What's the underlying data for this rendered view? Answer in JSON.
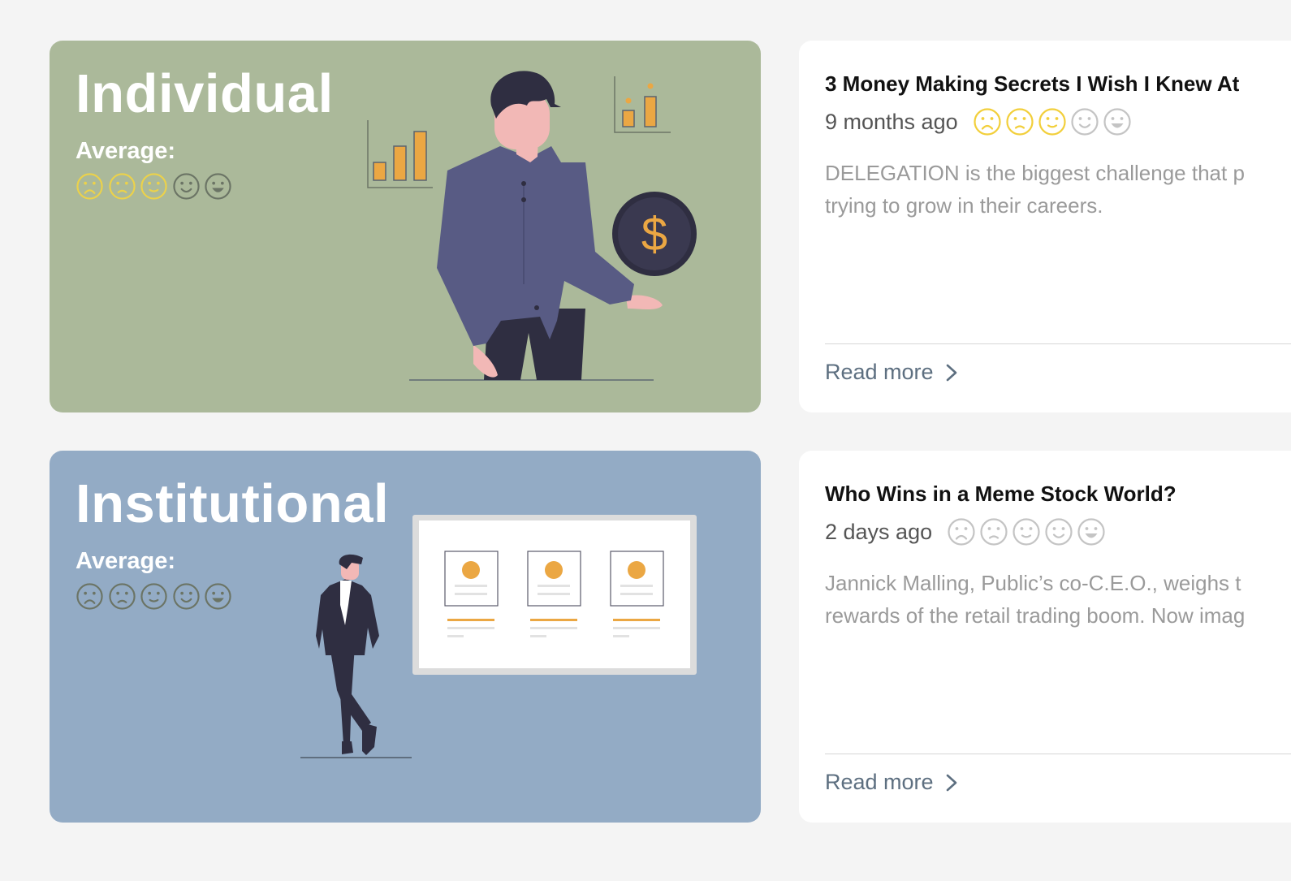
{
  "segments": [
    {
      "title": "Individual",
      "average_label": "Average:",
      "rating": [
        {
          "icon": "frown-face-icon",
          "active": true
        },
        {
          "icon": "slightly-frown-face-icon",
          "active": true
        },
        {
          "icon": "neutral-smile-face-icon",
          "active": true
        },
        {
          "icon": "smile-face-icon",
          "active": false
        },
        {
          "icon": "grin-face-icon",
          "active": false
        }
      ],
      "background": "#abb99a",
      "illustration": "person-with-dollar-coin-illustration"
    },
    {
      "title": "Institutional",
      "average_label": "Average:",
      "rating": [
        {
          "icon": "frown-face-icon",
          "active": false
        },
        {
          "icon": "slightly-frown-face-icon",
          "active": false
        },
        {
          "icon": "neutral-smile-face-icon",
          "active": false
        },
        {
          "icon": "smile-face-icon",
          "active": false
        },
        {
          "icon": "grin-face-icon",
          "active": false
        }
      ],
      "background": "#93abc5",
      "illustration": "businessman-with-board-illustration"
    }
  ],
  "articles": [
    {
      "title": "3 Money Making Secrets I Wish I Knew At",
      "time": "9 months ago",
      "rating": [
        {
          "icon": "frown-face-icon",
          "active": true
        },
        {
          "icon": "slightly-frown-face-icon",
          "active": true
        },
        {
          "icon": "neutral-smile-face-icon",
          "active": true
        },
        {
          "icon": "smile-face-icon",
          "active": false
        },
        {
          "icon": "grin-face-icon",
          "active": false
        }
      ],
      "excerpt_line1": "DELEGATION is the biggest challenge that p",
      "excerpt_line2": "trying to grow in their careers.",
      "read_more": "Read more"
    },
    {
      "title": "Who Wins in a Meme Stock World?",
      "time": "2 days ago",
      "rating": [
        {
          "icon": "frown-face-icon",
          "active": false
        },
        {
          "icon": "slightly-frown-face-icon",
          "active": false
        },
        {
          "icon": "neutral-smile-face-icon",
          "active": false
        },
        {
          "icon": "smile-face-icon",
          "active": false
        },
        {
          "icon": "grin-face-icon",
          "active": false
        }
      ],
      "excerpt_line1": "Jannick Malling, Public’s co-C.E.O., weighs t",
      "excerpt_line2": "rewards of the retail trading boom. Now imag",
      "read_more": "Read more"
    }
  ],
  "colors": {
    "page_bg": "#f4f4f4",
    "accent_orange": "#eba743",
    "rating_active_on_card": "#f2cf3b",
    "rating_active_on_hero": "#ecd24a",
    "rating_inactive_on_card": "#c4c4c4",
    "rating_inactive_on_hero": "#6b7465",
    "shirt": "#585b84",
    "dark": "#2f2e41",
    "skin": "#f2b8b6"
  }
}
